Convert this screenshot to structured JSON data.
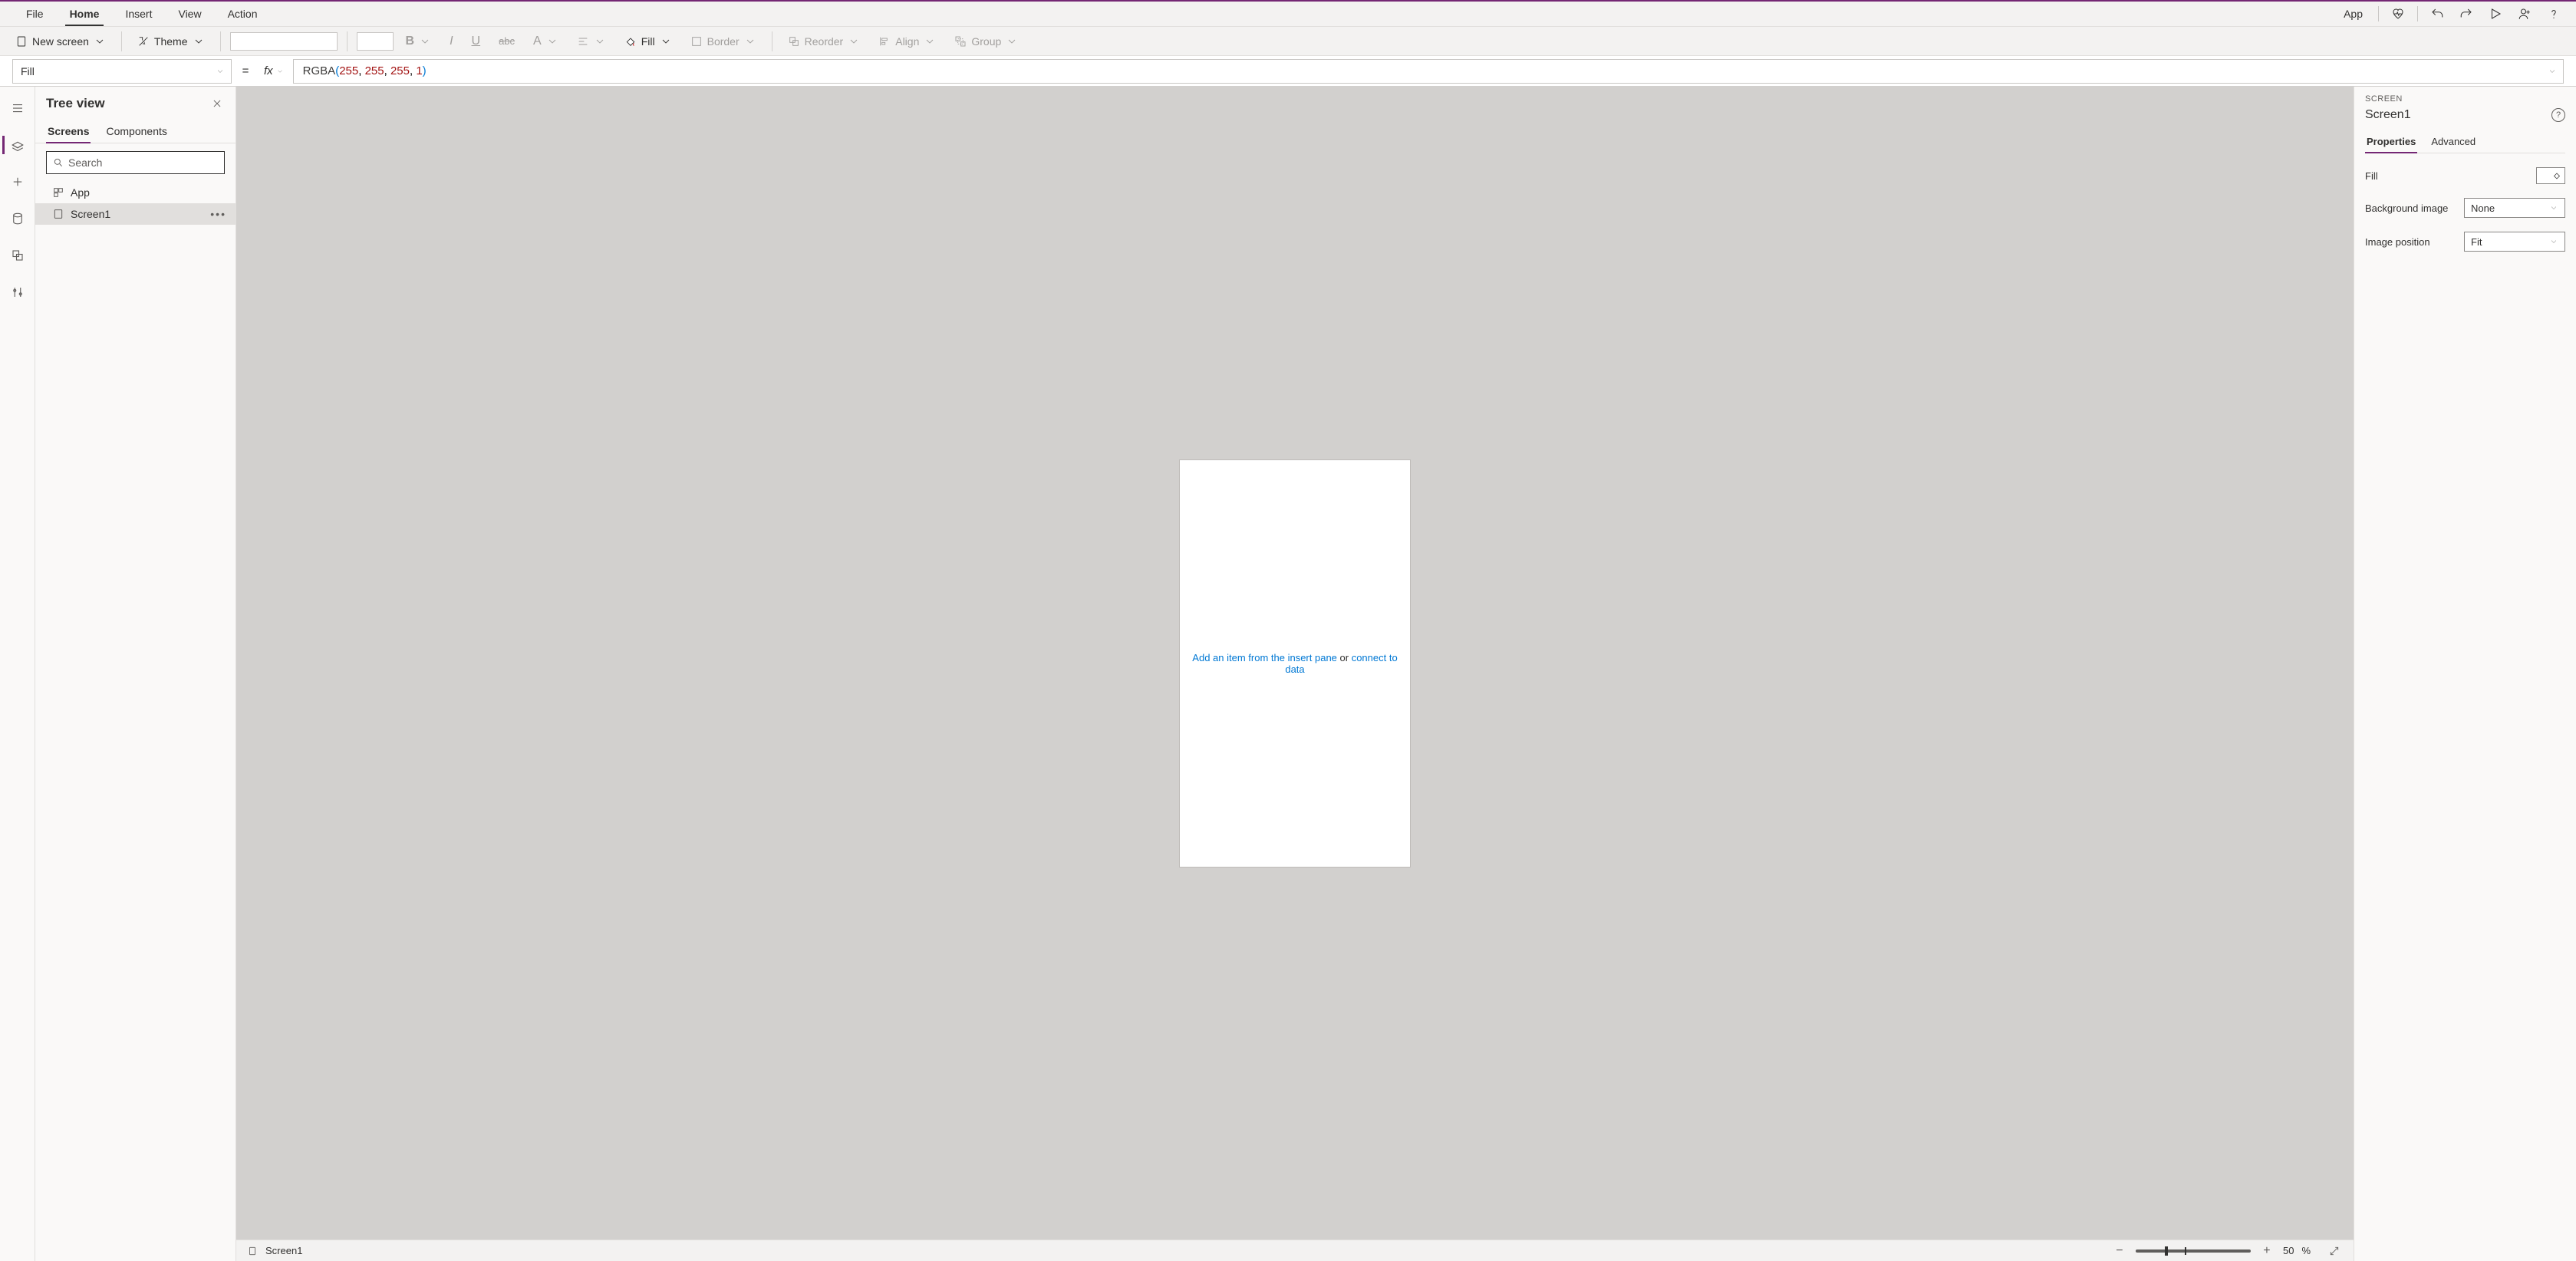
{
  "menubar": {
    "left_tabs": [
      "File",
      "Home",
      "Insert",
      "View",
      "Action"
    ],
    "active_tab_index": 1,
    "right": {
      "app_label": "App"
    }
  },
  "ribbon": {
    "new_screen": "New screen",
    "theme": "Theme",
    "fill_label": "Fill",
    "border_label": "Border",
    "reorder_label": "Reorder",
    "align_label": "Align",
    "group_label": "Group"
  },
  "formula_bar": {
    "property": "Fill",
    "fx_label": "fx",
    "formula": {
      "fn": "RGBA",
      "args": [
        "255",
        "255",
        "255",
        "1"
      ]
    }
  },
  "rail": {
    "items": [
      "menu",
      "tree-view",
      "insert",
      "data",
      "media",
      "advanced"
    ]
  },
  "tree": {
    "title": "Tree view",
    "tabs": [
      "Screens",
      "Components"
    ],
    "active_tab_index": 0,
    "search_placeholder": "Search",
    "items": [
      {
        "label": "App",
        "icon": "app",
        "selected": false
      },
      {
        "label": "Screen1",
        "icon": "screen",
        "selected": true
      }
    ]
  },
  "canvas": {
    "hint_prefix": "Add an item from the insert pane",
    "hint_mid": " or ",
    "hint_link": "connect to data",
    "status_screen": "Screen1",
    "zoom_value": "50",
    "zoom_pct": "%"
  },
  "props": {
    "section_label": "SCREEN",
    "screen_name": "Screen1",
    "tabs": [
      "Properties",
      "Advanced"
    ],
    "active_tab_index": 0,
    "rows": {
      "fill_label": "Fill",
      "bg_image_label": "Background image",
      "bg_image_value": "None",
      "img_pos_label": "Image position",
      "img_pos_value": "Fit"
    }
  }
}
